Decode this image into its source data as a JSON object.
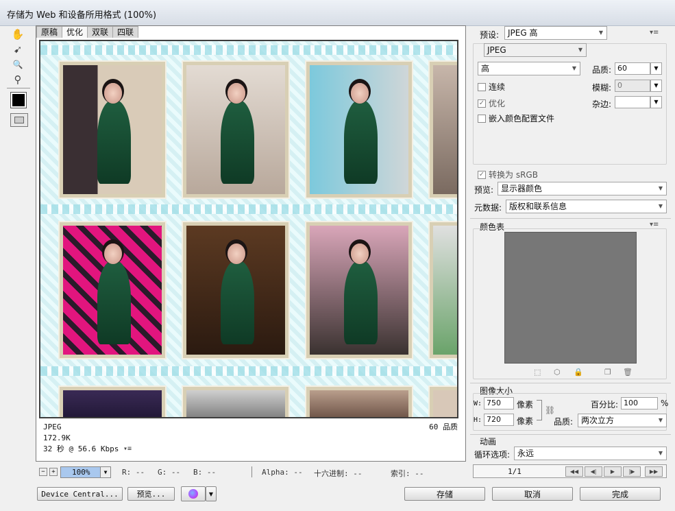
{
  "window": {
    "title": "存储为 Web 和设备所用格式 (100%)"
  },
  "tools": [
    {
      "name": "hand-tool-icon",
      "glyph": "✋"
    },
    {
      "name": "slice-select-tool-icon",
      "glyph": "➹"
    },
    {
      "name": "zoom-tool-icon",
      "glyph": "🔍"
    },
    {
      "name": "eyedropper-tool-icon",
      "glyph": "⚲"
    }
  ],
  "tabs": [
    "原稿",
    "优化",
    "双联",
    "四联"
  ],
  "preview_info": {
    "format": "JPEG",
    "size": "172.9K",
    "time": "32 秒 @ 56.6 Kbps",
    "quality": "60 品质"
  },
  "statusbar": {
    "zoom": "100%",
    "r": "R: --",
    "g": "G: --",
    "b": "B: --",
    "alpha": "Alpha: --",
    "hex": "十六进制: --",
    "index": "索引: --"
  },
  "buttons": {
    "device_central": "Device Central...",
    "preview": "预览...",
    "save": "存储",
    "cancel": "取消",
    "done": "完成"
  },
  "settings": {
    "preset_label": "预设:",
    "preset_value": "JPEG 高",
    "format_value": "JPEG",
    "compression_value": "高",
    "quality_label": "品质:",
    "quality_value": "60",
    "blur_label": "模糊:",
    "blur_value": "0",
    "matte_label": "杂边:",
    "progressive_label": "连续",
    "optimized_label": "优化",
    "embed_profile_label": "嵌入颜色配置文件",
    "convert_srgb_label": "转换为 sRGB",
    "preview_label": "预览:",
    "preview_value": "显示器颜色",
    "metadata_label": "元数据:",
    "metadata_value": "版权和联系信息"
  },
  "color_table": {
    "title": "颜色表",
    "swatch_color": "#777777"
  },
  "image_size": {
    "title": "图像大小",
    "w_label": "W:",
    "w_value": "750",
    "h_label": "H:",
    "h_value": "720",
    "unit": "像素",
    "percent_label": "百分比:",
    "percent_value": "100",
    "percent_unit": "%",
    "quality_label": "品质:",
    "quality_value": "两次立方"
  },
  "animation": {
    "title": "动画",
    "loop_label": "循环选项:",
    "loop_value": "永远",
    "frame_count": "1/1"
  }
}
